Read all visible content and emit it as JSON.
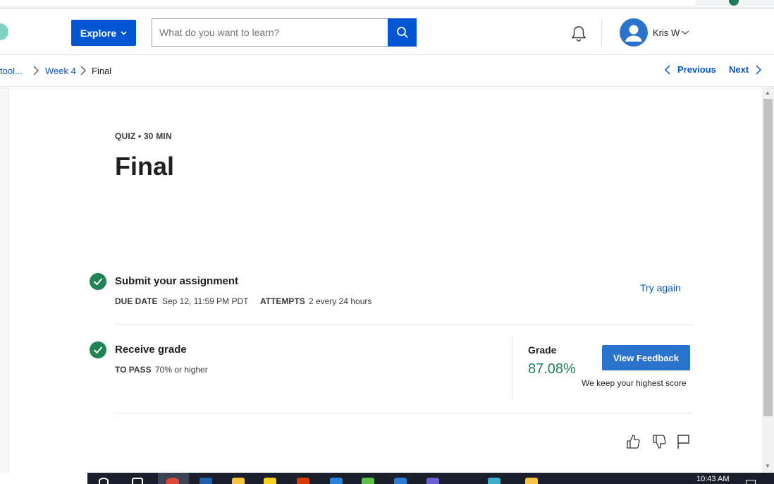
{
  "header": {
    "explore_label": "Explore",
    "search_placeholder": "What do you want to learn?",
    "user_name": "Kris W"
  },
  "breadcrumb": {
    "items": [
      "tool...",
      "Week 4",
      "Final"
    ],
    "previous_label": "Previous",
    "next_label": "Next"
  },
  "quiz": {
    "meta": "QUIZ • 30 MIN",
    "title": "Final"
  },
  "steps": {
    "submit": {
      "title": "Submit your assignment",
      "due_key": "DUE DATE",
      "due_value": "Sep 12, 11:59 PM PDT",
      "attempts_key": "ATTEMPTS",
      "attempts_value": "2 every 24 hours",
      "action_label": "Try again"
    },
    "grade": {
      "title": "Receive grade",
      "pass_key": "TO PASS",
      "pass_value": "70% or higher",
      "grade_label": "Grade",
      "grade_value": "87.08%",
      "feedback_label": "View Feedback",
      "note": "We keep your highest score"
    }
  },
  "taskbar": {
    "time": "10:43 AM"
  },
  "colors": {
    "brand_blue": "#0056d2",
    "success_green": "#1f8354",
    "button_blue": "#2a73cc"
  }
}
